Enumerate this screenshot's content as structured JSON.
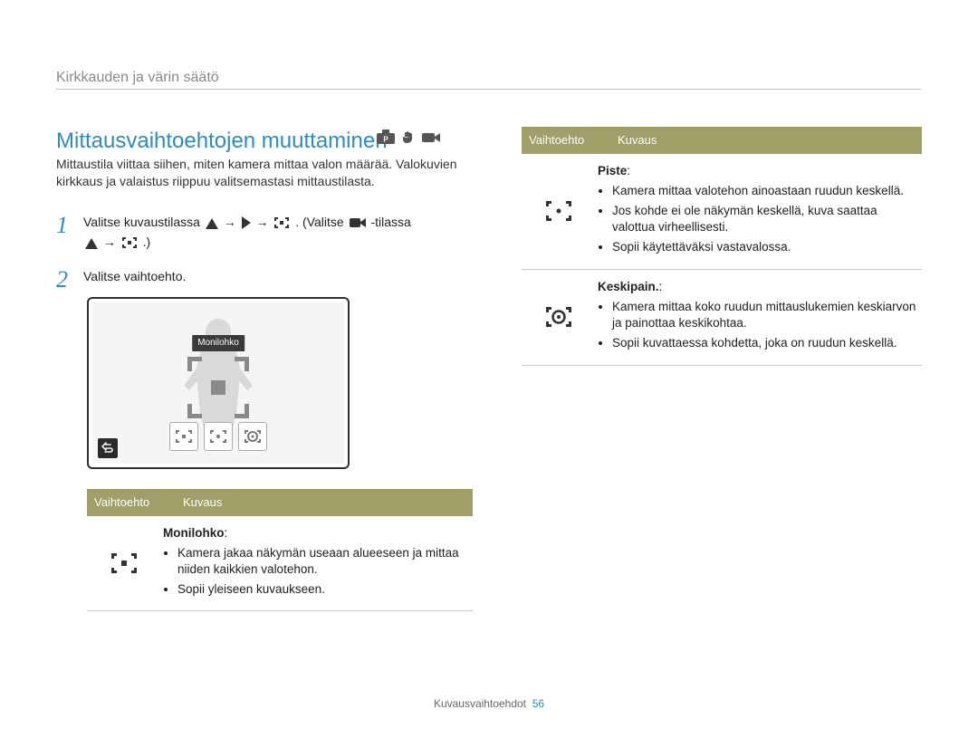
{
  "breadcrumb": "Kirkkauden ja värin säätö",
  "title": "Mittausvaihtoehtojen muuttaminen",
  "intro": "Mittaustila viittaa siihen, miten kamera mittaa valon määrää. Valokuvien kirkkaus ja valaistus riippuu valitsemastasi mittaustilasta.",
  "steps": {
    "s1": {
      "num": "1",
      "a": "Valitse kuvaustilassa",
      "b": ". (Valitse",
      "c": "-tilassa",
      "d": ".)"
    },
    "s2": {
      "num": "2",
      "text": "Valitse vaihtoehto."
    }
  },
  "illustration": {
    "tag": "Monilohko"
  },
  "arrow": "→",
  "columns": {
    "opt": "Vaihtoehto",
    "desc": "Kuvaus"
  },
  "left_option": {
    "name": "Monilohko",
    "colon": ":",
    "b1": "Kamera jakaa näkymän useaan alueeseen ja mittaa niiden kaikkien valotehon.",
    "b2": "Sopii yleiseen kuvaukseen."
  },
  "right_options": {
    "r1": {
      "name": "Piste",
      "colon": ":",
      "b1": "Kamera mittaa valotehon ainoastaan ruudun keskellä.",
      "b2": "Jos kohde ei ole näkymän keskellä, kuva saattaa valottua virheellisesti.",
      "b3": "Sopii käytettäväksi vastavalossa."
    },
    "r2": {
      "name": "Keskipain.",
      "colon": ":",
      "b1": "Kamera mittaa koko ruudun mittauslukemien keskiarvon ja painottaa keskikohtaa.",
      "b2": "Sopii kuvattaessa kohdetta, joka on ruudun keskellä."
    }
  },
  "footer": {
    "section": "Kuvausvaihtoehdot",
    "page": "56"
  }
}
